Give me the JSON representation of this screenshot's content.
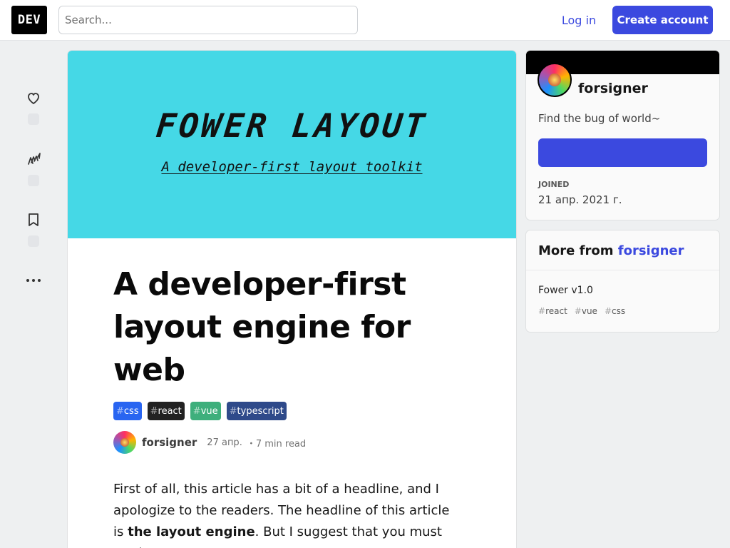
{
  "header": {
    "logo": "DEV",
    "search_placeholder": "Search...",
    "login_label": "Log in",
    "create_label": "Create account"
  },
  "reactions": {
    "icons": [
      "heart-icon",
      "unicorn-icon",
      "bookmark-icon",
      "more-icon"
    ]
  },
  "cover": {
    "title": "FOWER LAYOUT",
    "subtitle": "A developer-first layout toolkit",
    "bg_color": "#45d8e6"
  },
  "article": {
    "title": "A developer-first layout engine for web",
    "tags": [
      {
        "name": "css",
        "color": "#2965f1"
      },
      {
        "name": "react",
        "color": "#222222"
      },
      {
        "name": "vue",
        "color": "#3eaf7c"
      },
      {
        "name": "typescript",
        "color": "#2f4a8a"
      }
    ],
    "author": "forsigner",
    "date": "27 апр.",
    "read_time": "・7 min read",
    "body_1": "First of all, this article has a bit of a headline, and I apologize to the readers. The headline of this article is ",
    "body_bold": "the layout engine",
    "body_2": ". But I suggest that you must read"
  },
  "profile": {
    "name": "forsigner",
    "bio": "Find the bug of world~",
    "joined_label": "Joined",
    "joined_date": "21 апр. 2021 г."
  },
  "more_from": {
    "label": "More from",
    "author": "forsigner",
    "item_title": "Fower v1.0",
    "item_tags": [
      "react",
      "vue",
      "css"
    ]
  },
  "colors": {
    "accent": "#3b49df",
    "background": "#eef0f1"
  }
}
